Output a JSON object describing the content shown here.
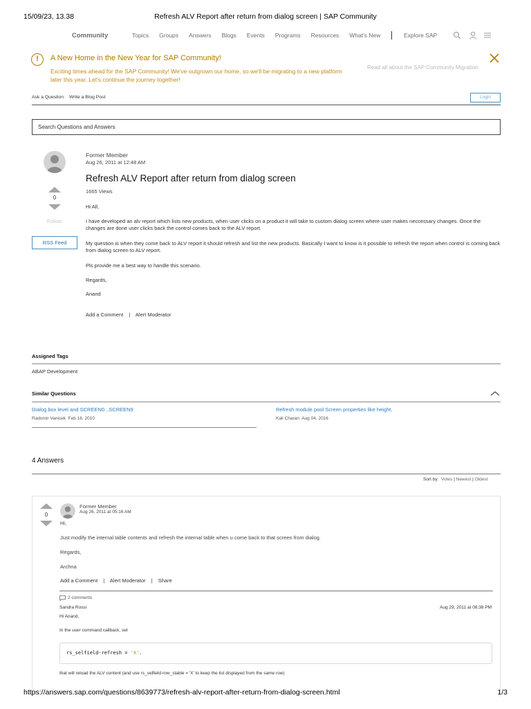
{
  "print": {
    "datetime": "15/09/23, 13.38",
    "title": "Refresh ALV Report after return from dialog screen | SAP Community",
    "url": "https://answers.sap.com/questions/8639773/refresh-alv-report-after-return-from-dialog-screen.html",
    "page": "1/3"
  },
  "nav": {
    "brand": "Community",
    "items": [
      "Topics",
      "Groups",
      "Answers",
      "Blogs",
      "Events",
      "Programs",
      "Resources",
      "What's New"
    ],
    "explore": "Explore SAP"
  },
  "banner": {
    "title": "A New Home in the New Year for SAP Community!",
    "body": "Exciting times ahead for the SAP Community! We've outgrown our home, so we'll be migrating to a new platform later this year. Let's continue the journey together!",
    "link": "Read all about the SAP Community Migration",
    "color": "#b07b00"
  },
  "actions": {
    "ask": "Ask a Question",
    "write": "Write a Blog Post",
    "login": "Login"
  },
  "search": {
    "placeholder": "Search Questions and Answers"
  },
  "question": {
    "author": "Former Member",
    "date": "Aug 26, 2011 at 12:48 AM",
    "title": "Refresh ALV Report after return from dialog screen",
    "views": "1665 Views",
    "votes": "0",
    "follow": "Follow",
    "rss": "RSS Feed",
    "paragraphs": [
      "Hi All,",
      "I have developed an alv report which lists new products, when user clicks on a product it will take to custom dialog screen where user makes neccessary changes. Once the changes are done user clicks back the control comes back to the ALV report.",
      "My question is when they come back to ALV report it should refresh and list the new products. Basically I want to know is it possible to refresh the report when control is coming back from dialog screen to ALV report.",
      "Pls provide me a best way to handle this scenario.",
      "Regards,",
      "Anand"
    ],
    "add_comment": "Add a Comment",
    "alert": "Alert Moderator",
    "separator": "|"
  },
  "tags": {
    "heading": "Assigned Tags",
    "items": [
      "ABAP Development"
    ]
  },
  "similar": {
    "heading": "Similar Questions",
    "items": [
      {
        "title": "Dialog box level and SCREEN0...SCREEN9",
        "author": "Radomir Vanicek",
        "date": "Feb 18, 2010"
      },
      {
        "title": "Refresh module pool Screen properties like height.",
        "author": "Kali Charan",
        "date": "Aug 04, 2016"
      }
    ]
  },
  "answers": {
    "count": "4 Answers",
    "sort_label": "Sort by:",
    "sort_options": [
      "Votes",
      "Newest",
      "Oldest"
    ],
    "items": [
      {
        "author": "Former Member",
        "date": "Aug 26, 2011 at 05:16 AM",
        "votes": "0",
        "paragraphs": [
          "Hi,",
          "Just modify the internal table contents and refresh the internal table when u come back to that screen from dialog.",
          "Regards,",
          "Archna"
        ],
        "add_comment": "Add a Comment",
        "alert": "Alert Moderator",
        "share": "Share",
        "comments_count": "2 comments",
        "comments": [
          {
            "author": "Sandra Rossi",
            "date": "Aug 29, 2011 at 08:38 PM",
            "lines": [
              "Hi Anand,",
              "In the user command callback, set"
            ],
            "code_lhs": "rs_selfield-refresh = ",
            "code_str": "'X'",
            "code_end": ".",
            "after": "that will reload the ALV content (and use rs_selfield-row_stable = 'X' to keep the list displayed from the same row)"
          }
        ]
      }
    ]
  }
}
